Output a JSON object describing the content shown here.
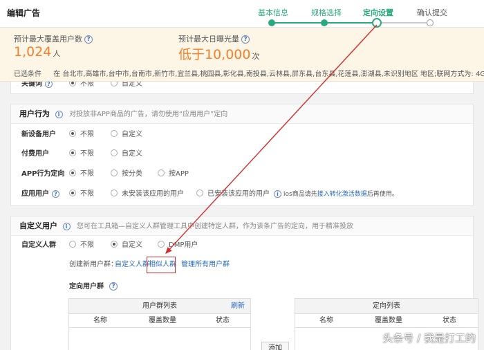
{
  "header": {
    "title": "编辑广告",
    "steps": [
      {
        "label": "基本信息",
        "state": "done"
      },
      {
        "label": "规格选择",
        "state": "done"
      },
      {
        "label": "定向设置",
        "state": "current"
      },
      {
        "label": "确认提交",
        "state": "todo"
      }
    ]
  },
  "summary": {
    "users_label": "预计最大覆盖用户数",
    "users_value": "1,024",
    "users_unit": "人",
    "exposure_label": "预计最大日曝光量",
    "exposure_value": "低于10,000",
    "exposure_unit": "次",
    "filters_label": "已选条件",
    "filters_text": "在 台北市,高雄市,台中市,台南市,新竹市,宜兰县,桃园县,彰化县,南投县,云林县,屏东县,台东县,花莲县,澎湖县,未识别地区 地区;联网方式为: 4G"
  },
  "keyword_row": {
    "label": "关键词",
    "options": [
      "不限",
      "自定义"
    ]
  },
  "behavior": {
    "title": "用户行为",
    "tip": "对投放非APP商品的广告，请勿使用“应用用户”定向",
    "rows": [
      {
        "label": "新设备用户",
        "options": [
          "不限",
          "自定义"
        ]
      },
      {
        "label": "付费用户",
        "options": [
          "不限",
          "自定义"
        ]
      },
      {
        "label": "APP行为定向",
        "options": [
          "不限",
          "按分类",
          "按APP"
        ]
      },
      {
        "label": "应用用户",
        "options": [
          "不限",
          "未安装该应用的用户",
          "已安装该应用的用户"
        ]
      }
    ],
    "ios_note_prefix": "ios商品请先",
    "ios_note_link": "接入转化激活数据",
    "ios_note_suffix": "后再使用。"
  },
  "custom": {
    "title": "自定义用户",
    "tip": "您可在工具箱—自定义人群管理工具中创建特定人群，作为该条广告的定向，用于精准投放",
    "row_label": "自定义人群",
    "options": [
      "不限",
      "自定义",
      "DMP用户"
    ],
    "create_label": "创建新用户群：",
    "create_links": [
      "自定义人群",
      "相似人群",
      "管理所有用户群"
    ],
    "targeting_label": "定向用户群",
    "left_table": {
      "title": "用户群列表",
      "refresh": "刷新",
      "cols": [
        "名称",
        "覆盖数量",
        "状态"
      ]
    },
    "right_table": {
      "title": "定向列表",
      "cols": [
        "名称",
        "覆盖数量",
        "状态"
      ]
    },
    "add_button": "添加"
  },
  "watermark": "头条号 / 我是打工的",
  "colors": {
    "accent": "#2aa97b",
    "warning": "#f5802a",
    "link": "#2a6bbf",
    "annotation": "#d62b2b"
  }
}
